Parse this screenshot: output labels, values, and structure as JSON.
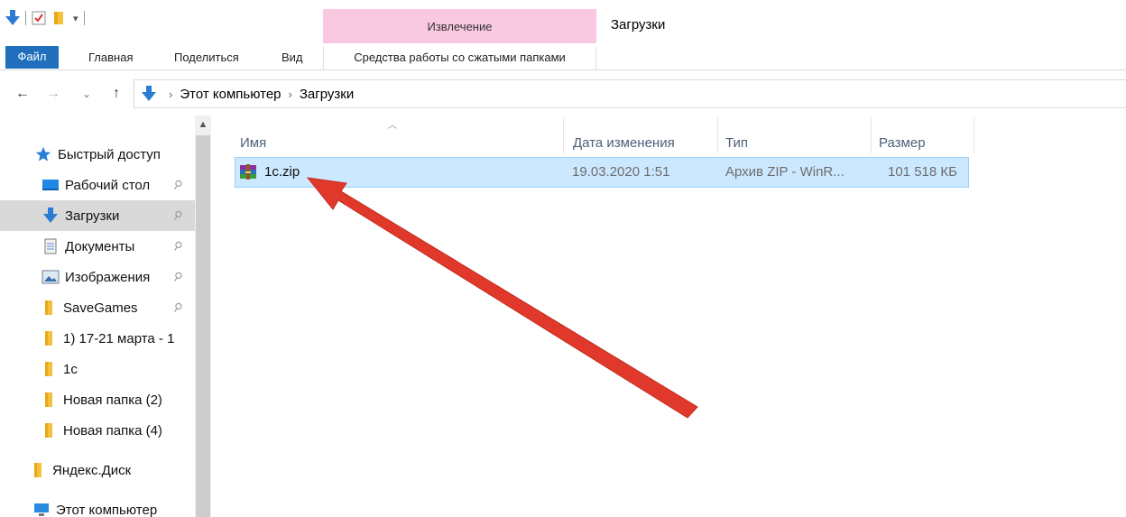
{
  "window": {
    "title": "Загрузки"
  },
  "ribbon": {
    "context_group": "Извлечение",
    "tabs": {
      "file": "Файл",
      "home": "Главная",
      "share": "Поделиться",
      "view": "Вид",
      "tools": "Средства работы со сжатыми папками"
    }
  },
  "address": {
    "crumbs": [
      "Этот компьютер",
      "Загрузки"
    ]
  },
  "sidebar": {
    "items": [
      {
        "label": "Быстрый доступ",
        "icon": "star-icon"
      },
      {
        "label": "Рабочий стол",
        "icon": "desktop-icon",
        "pinned": true
      },
      {
        "label": "Загрузки",
        "icon": "download-arrow-icon",
        "pinned": true,
        "selected": true
      },
      {
        "label": "Документы",
        "icon": "document-icon",
        "pinned": true
      },
      {
        "label": "Изображения",
        "icon": "pictures-icon",
        "pinned": true
      },
      {
        "label": "SaveGames",
        "icon": "folder-icon",
        "pinned": true
      },
      {
        "label": "1) 17-21 марта - 1",
        "icon": "folder-icon"
      },
      {
        "label": "1c",
        "icon": "folder-icon"
      },
      {
        "label": "Новая папка (2)",
        "icon": "folder-icon"
      },
      {
        "label": "Новая папка (4)",
        "icon": "folder-icon"
      },
      {
        "label": "Яндекс.Диск",
        "icon": "folder-icon"
      },
      {
        "label": "Этот компьютер",
        "icon": "computer-icon"
      }
    ]
  },
  "columns": {
    "name": "Имя",
    "date": "Дата изменения",
    "type": "Тип",
    "size": "Размер"
  },
  "files": [
    {
      "name": "1c.zip",
      "date": "19.03.2020 1:51",
      "type": "Архив ZIP - WinR...",
      "size": "101 518 КБ",
      "icon": "winrar-archive-icon",
      "selected": true
    }
  ],
  "colors": {
    "accent": "#1f6fbd",
    "context_tab": "#f9c9e2",
    "selection": "#cce8ff",
    "annotation_arrow": "#e0392b"
  }
}
